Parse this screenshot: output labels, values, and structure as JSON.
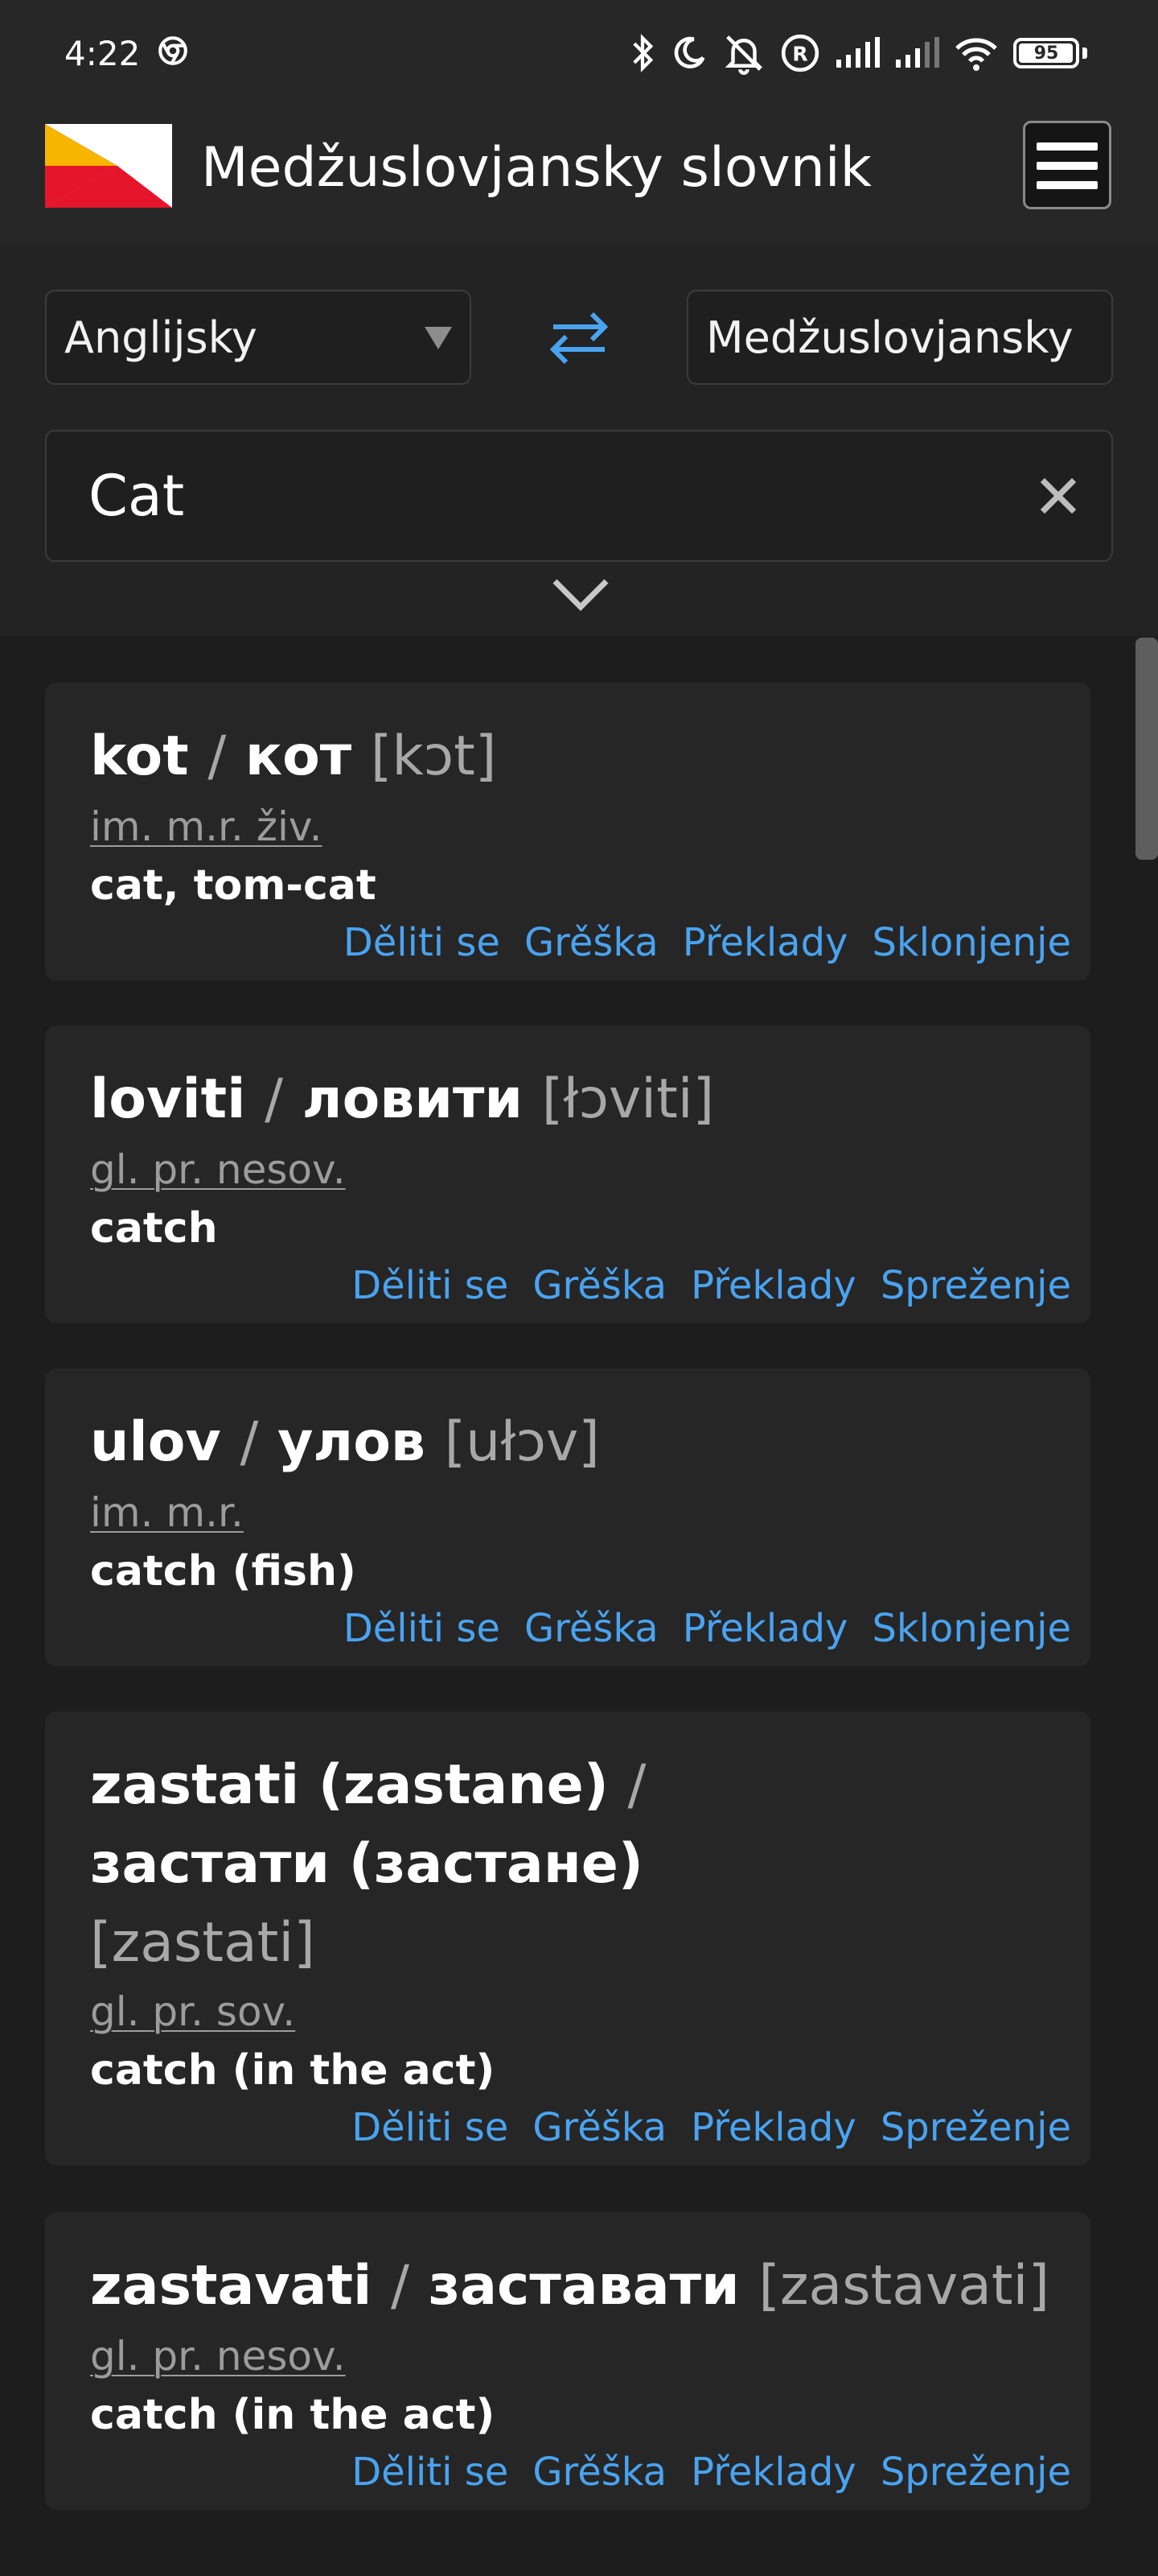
{
  "status_bar": {
    "time": "4:22",
    "battery": "95",
    "icons": [
      "chrome-icon",
      "bluetooth-icon",
      "moon-icon",
      "bell-off-icon",
      "registered-icon",
      "signal-icon",
      "signal-icon",
      "wifi-icon",
      "battery-icon"
    ]
  },
  "header": {
    "title": "Medžuslovjansky slovnik",
    "flag_colors": [
      "#f7b500",
      "#0b3fa8",
      "#e5152b",
      "#ffffff"
    ],
    "menu_icon": "hamburger-menu-icon"
  },
  "controls": {
    "from_language": "Anglijsky",
    "to_language": "Medžuslovjansky",
    "swap_icon": "swap-arrows-icon",
    "search_value": "Cat",
    "clear_icon": "close-icon",
    "expand_icon": "chevron-down-icon"
  },
  "actions_labels": {
    "share": "Děliti se",
    "error": "Grěška",
    "translations": "Překlady",
    "declension": "Sklonjenje",
    "conjugation": "Sprežen­je"
  },
  "results": [
    {
      "latin": "kot",
      "slash": "/",
      "cyrillic": "кот",
      "ipa": "[kɔt]",
      "pos": "im. m.r. živ.",
      "translation": "cat, tom-cat",
      "actions": [
        "Děliti se",
        "Grěška",
        "Překlady",
        "Sklonjenje"
      ]
    },
    {
      "latin": "loviti",
      "slash": "/",
      "cyrillic": "ловити",
      "ipa": "[łɔviti]",
      "pos": "gl. pr. nesov.",
      "translation": "catch",
      "actions": [
        "Děliti se",
        "Grěška",
        "Překlady",
        "Sprežen­je"
      ]
    },
    {
      "latin": "ulov",
      "slash": "/",
      "cyrillic": "улов",
      "ipa": "[ułɔv]",
      "pos": "im. m.r.",
      "translation": "catch (fish)",
      "actions": [
        "Děliti se",
        "Grěška",
        "Překlady",
        "Sklonjenje"
      ]
    },
    {
      "latin": "zastati (zastane)",
      "slash": "/",
      "cyrillic": "застати (застане)",
      "ipa": "[zastati]",
      "pos": "gl. pr. sov.",
      "translation": "catch (in the act)",
      "actions": [
        "Děliti se",
        "Grěška",
        "Překlady",
        "Sprežen­je"
      ]
    },
    {
      "latin": "zastavati",
      "slash": "/",
      "cyrillic": "заставати",
      "ipa": "[zastavati]",
      "pos": "gl. pr. nesov.",
      "translation": "catch (in the act)",
      "actions": [
        "Děliti se",
        "Grěška",
        "Překlady",
        "Sprežen­je"
      ]
    }
  ],
  "colors": {
    "accent": "#4aa3f0",
    "background": "#1d1d1d",
    "card": "#262626"
  }
}
